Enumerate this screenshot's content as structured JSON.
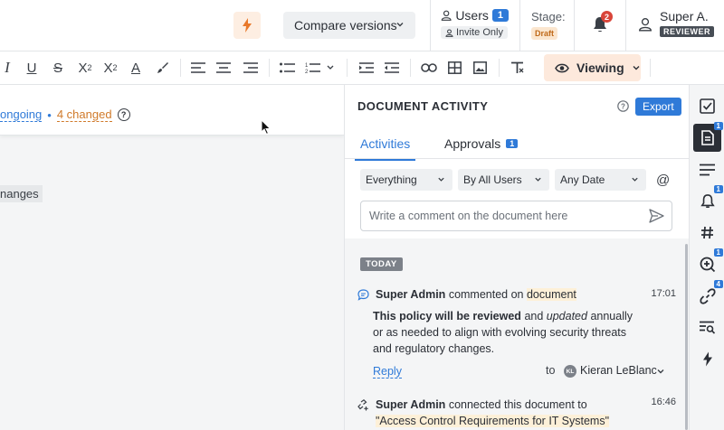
{
  "topbar": {
    "compare_label": "Compare versions",
    "users_label": "Users",
    "users_count": "1",
    "invite_label": "Invite Only",
    "stage_label": "Stage:",
    "stage_value": "Draft",
    "notifications_count": "2",
    "user_name": "Super A.",
    "user_role": "REVIEWER"
  },
  "toolbar": {
    "viewing_label": "Viewing"
  },
  "doc": {
    "status_ongoing": "ongoing",
    "status_sep": "•",
    "status_changed": "4 changed",
    "changes_chip": "nanges"
  },
  "panel": {
    "title": "DOCUMENT ACTIVITY",
    "export_label": "Export",
    "tabs": [
      {
        "label": "Activities"
      },
      {
        "label": "Approvals",
        "badge": "1"
      }
    ],
    "filters": [
      "Everything",
      "By All Users",
      "Any Date"
    ],
    "comment_placeholder": "Write a comment on the document here",
    "day_label": "TODAY",
    "activities": [
      {
        "who": "Super Admin",
        "action": "commented on",
        "target": "document",
        "time": "17:01",
        "body_bold": "This policy will be reviewed",
        "body_mid": "and",
        "body_italic": "updated",
        "body_rest": "annually or as needed to align with evolving security threats and regulatory changes.",
        "reply_label": "Reply",
        "to_label": "to",
        "to_initials": "KL",
        "to_name": "Kieran LeBlanc"
      },
      {
        "who": "Super Admin",
        "action": "connected this document to",
        "target": "\"Access Control Requirements for IT Systems\"",
        "time": "16:46"
      }
    ]
  },
  "rail": {
    "badges": {
      "document": "1",
      "notifications": "1",
      "comments": "1",
      "links": "4"
    }
  },
  "colors": {
    "accent": "#2f7ad8",
    "warning": "#d07a2a",
    "draft_bg": "#fbe6cf",
    "danger": "#d9453a"
  }
}
